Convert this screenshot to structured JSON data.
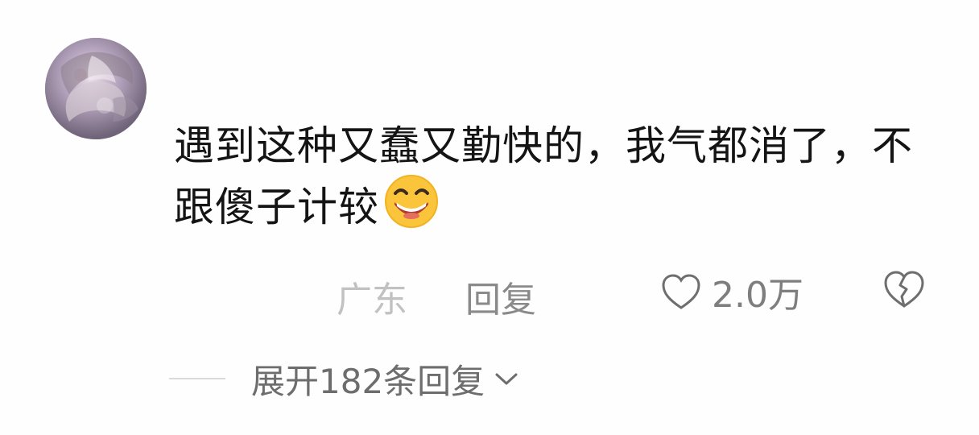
{
  "comment": {
    "text": "遇到这种又蠢又勤快的，我气都消了，不跟傻子计较",
    "emoji": "grinning-face-emoji"
  },
  "meta": {
    "location": "广东",
    "reply_label": "回复",
    "like_count": "2.0万"
  },
  "replies": {
    "expand_label": "展开182条回复"
  },
  "icons": {
    "like": "heart-outline-icon",
    "dislike": "broken-heart-outline-icon",
    "expand": "chevron-down-icon"
  },
  "colors": {
    "text_primary": "#141414",
    "meta_location": "#c1c1c1",
    "meta_reply": "#8a8a8a",
    "like_count": "#7e7e7e",
    "expand_text": "#6d6d6d",
    "divider": "#dadada"
  }
}
